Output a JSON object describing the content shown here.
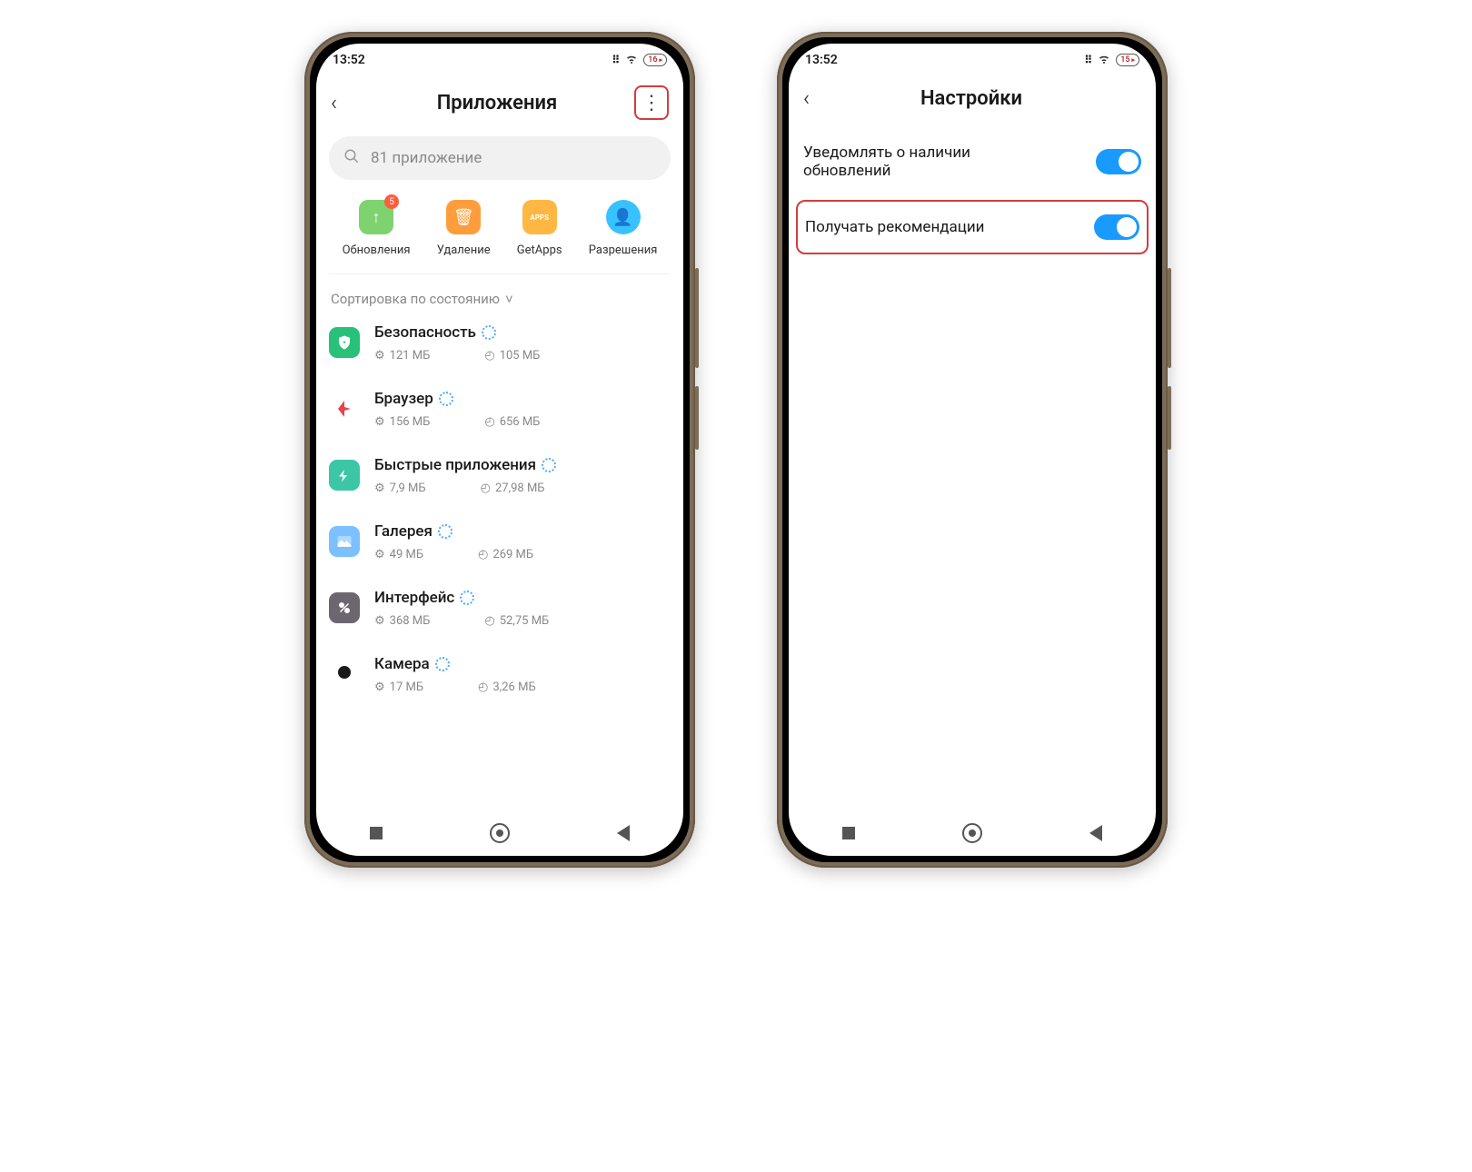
{
  "status": {
    "time": "13:52",
    "battery1": "16",
    "battery2": "15"
  },
  "screen1": {
    "title": "Приложения",
    "search_placeholder": "81 приложение",
    "quick": [
      {
        "label": "Обновления",
        "badge": "5"
      },
      {
        "label": "Удаление"
      },
      {
        "label": "GetApps"
      },
      {
        "label": "Разрешения"
      }
    ],
    "sort_label": "Сортировка по состоянию",
    "apps": [
      {
        "name": "Безопасность",
        "size": "121 МБ",
        "time": "105 МБ"
      },
      {
        "name": "Браузер",
        "size": "156 МБ",
        "time": "656 МБ"
      },
      {
        "name": "Быстрые приложения",
        "size": "7,9 МБ",
        "time": "27,98 МБ"
      },
      {
        "name": "Галерея",
        "size": "49 МБ",
        "time": "269 МБ"
      },
      {
        "name": "Интерфейс",
        "size": "368 МБ",
        "time": "52,75 МБ"
      },
      {
        "name": "Камера",
        "size": "17 МБ",
        "time": "3,26 МБ"
      }
    ]
  },
  "screen2": {
    "title": "Настройки",
    "settings": [
      {
        "label": "Уведомлять о наличии обновлений",
        "highlight": false
      },
      {
        "label": "Получать рекомендации",
        "highlight": true
      }
    ]
  }
}
